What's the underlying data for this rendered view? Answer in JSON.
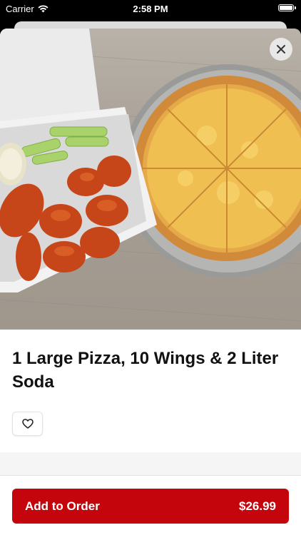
{
  "status_bar": {
    "carrier": "Carrier",
    "time": "2:58 PM"
  },
  "item": {
    "title": "1 Large Pizza, 10 Wings & 2 Liter Soda",
    "image_icon": "pizza-wings-photo"
  },
  "actions": {
    "add_to_order_label": "Add to Order",
    "price": "$26.99"
  },
  "colors": {
    "accent": "#c4060c"
  }
}
